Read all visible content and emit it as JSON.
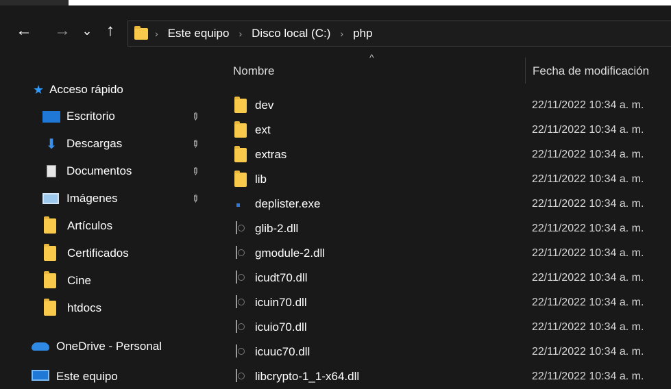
{
  "nav": {
    "back_icon": "←",
    "forward_icon": "→",
    "recent_icon": "⌄",
    "up_icon": "↑",
    "breadcrumb": [
      "Este equipo",
      "Disco local (C:)",
      "php"
    ],
    "separator": "›"
  },
  "sidebar": {
    "quick_access": {
      "label": "Acceso rápido",
      "icon": "star-icon",
      "color": "#2f9bff"
    },
    "pinned": [
      {
        "label": "Escritorio",
        "icon": "desktop-icon",
        "pinned": true
      },
      {
        "label": "Descargas",
        "icon": "download-icon",
        "pinned": true
      },
      {
        "label": "Documentos",
        "icon": "document-icon",
        "pinned": true
      },
      {
        "label": "Imágenes",
        "icon": "pictures-icon",
        "pinned": true
      }
    ],
    "folders": [
      {
        "label": "Artículos",
        "icon": "folder-icon"
      },
      {
        "label": "Certificados",
        "icon": "folder-icon"
      },
      {
        "label": "Cine",
        "icon": "folder-icon"
      },
      {
        "label": "htdocs",
        "icon": "folder-icon"
      }
    ],
    "onedrive": {
      "label": "OneDrive - Personal",
      "icon": "cloud-icon"
    },
    "this_pc": {
      "label": "Este equipo",
      "icon": "computer-icon"
    }
  },
  "columns": {
    "name": "Nombre",
    "modified": "Fecha de modificación",
    "sort_icon": "^"
  },
  "files": [
    {
      "name": "dev",
      "type": "folder",
      "modified": "22/11/2022 10:34 a. m."
    },
    {
      "name": "ext",
      "type": "folder",
      "modified": "22/11/2022 10:34 a. m."
    },
    {
      "name": "extras",
      "type": "folder",
      "modified": "22/11/2022 10:34 a. m."
    },
    {
      "name": "lib",
      "type": "folder",
      "modified": "22/11/2022 10:34 a. m."
    },
    {
      "name": "deplister.exe",
      "type": "exe",
      "modified": "22/11/2022 10:34 a. m."
    },
    {
      "name": "glib-2.dll",
      "type": "dll",
      "modified": "22/11/2022 10:34 a. m."
    },
    {
      "name": "gmodule-2.dll",
      "type": "dll",
      "modified": "22/11/2022 10:34 a. m."
    },
    {
      "name": "icudt70.dll",
      "type": "dll",
      "modified": "22/11/2022 10:34 a. m."
    },
    {
      "name": "icuin70.dll",
      "type": "dll",
      "modified": "22/11/2022 10:34 a. m."
    },
    {
      "name": "icuio70.dll",
      "type": "dll",
      "modified": "22/11/2022 10:34 a. m."
    },
    {
      "name": "icuuc70.dll",
      "type": "dll",
      "modified": "22/11/2022 10:34 a. m."
    },
    {
      "name": "libcrypto-1_1-x64.dll",
      "type": "dll",
      "modified": "22/11/2022 10:34 a. m."
    }
  ],
  "colors": {
    "background": "#191919",
    "folder": "#f8c94b",
    "accent": "#2f7ad6"
  }
}
